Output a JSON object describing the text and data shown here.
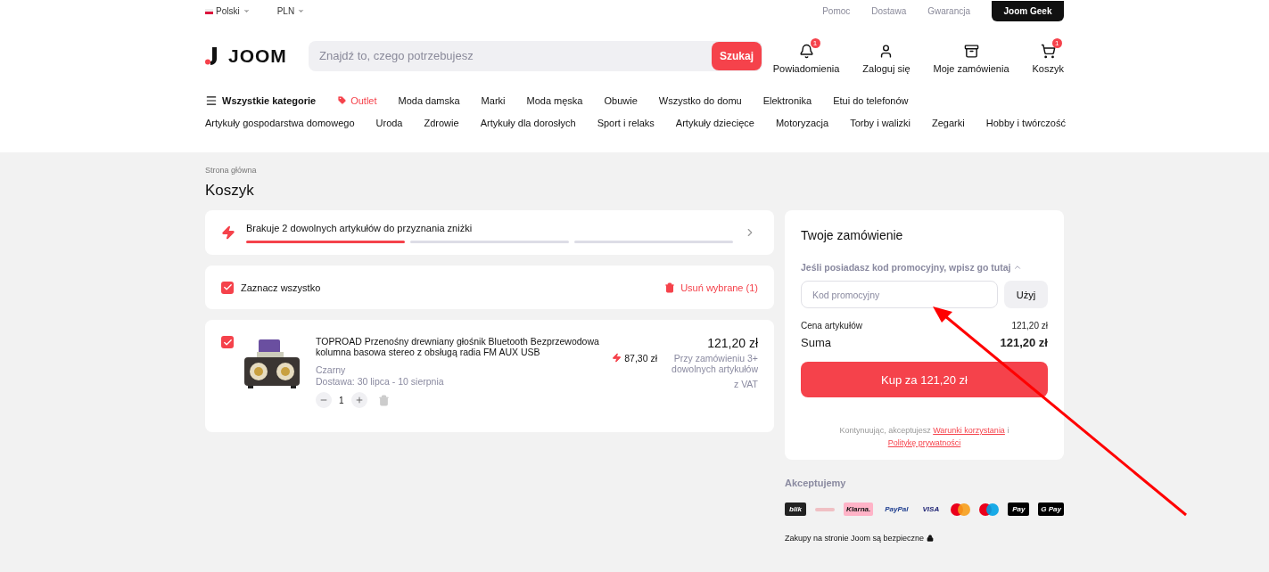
{
  "top_bar": {
    "language": "Polski",
    "currency": "PLN",
    "links": [
      "Pomoc",
      "Dostawa",
      "Gwarancja"
    ],
    "geek_button": "Joom Geek"
  },
  "header": {
    "logo": "JOOM",
    "search": {
      "placeholder": "Znajdź to, czego potrzebujesz",
      "button": "Szukaj"
    },
    "actions": [
      {
        "kind": "bell",
        "label": "Powiadomienia",
        "badge": "1"
      },
      {
        "kind": "user",
        "label": "Zaloguj się"
      },
      {
        "kind": "box",
        "label": "Moje zamówienia"
      },
      {
        "kind": "cart",
        "label": "Koszyk",
        "badge": "1"
      }
    ]
  },
  "categories": {
    "all": "Wszystkie kategorie",
    "row_1": [
      {
        "label": "Outlet",
        "kind": "promo"
      },
      {
        "label": "Moda damska",
        "kind": "plain"
      },
      {
        "label": "Marki",
        "kind": "plain"
      },
      {
        "label": "Moda męska",
        "kind": "plain"
      },
      {
        "label": "Obuwie",
        "kind": "plain"
      },
      {
        "label": "Wszystko do domu",
        "kind": "plain"
      },
      {
        "label": "Elektronika",
        "kind": "plain"
      },
      {
        "label": "Etui do telefonów",
        "kind": "plain"
      }
    ],
    "row_2": [
      "Artykuły gospodarstwa domowego",
      "Uroda",
      "Zdrowie",
      "Artykuły dla dorosłych",
      "Sport i relaks",
      "Artykuły dziecięce",
      "Motoryzacja",
      "Torby i walizki",
      "Zegarki",
      "Hobby i twórczość"
    ]
  },
  "breadcrumb": "Strona główna",
  "title": "Koszyk",
  "discount": {
    "text": "Brakuje 2 dowolnych artykułów do przyznania zniżki",
    "segments": [
      {
        "filled": true
      },
      {
        "filled": false
      },
      {
        "filled": false
      }
    ]
  },
  "select_all": {
    "label": "Zaznacz wszystko",
    "checked": true,
    "remove": "Usuń wybrane (1)"
  },
  "items": [
    {
      "checked": true,
      "name": "TOPROAD Przenośny drewniany głośnik Bluetooth Bezprzewodowa kolumna basowa stereo z obsługą radia FM AUX USB",
      "variant": "Czarny",
      "delivery": "Dostawa: 30 lipca - 10 sierpnia",
      "quantity": "1",
      "price": "121,20 zł",
      "bulk_price": "87,30 zł",
      "bulk_note": "Przy zamówieniu 3+ dowolnych artykułów",
      "vat": "z VAT"
    }
  ],
  "order": {
    "title": "Twoje zamówienie",
    "promo_toggle": "Jeśli posiadasz kod promocyjny, wpisz go tutaj",
    "promo_expanded": true,
    "promo_placeholder": "Kod promocyjny",
    "apply_button": "Użyj",
    "rows": [
      {
        "label": "Cena artykułów",
        "value": "121,20 zł",
        "kind": "normal"
      },
      {
        "label": "Suma",
        "value": "121,20 zł",
        "kind": "total"
      }
    ],
    "buy_button": "Kup za 121,20 zł",
    "terms_prefix": "Kontynuując, akceptujesz",
    "terms_link": "Warunki korzystania",
    "terms_and": "i",
    "privacy_link": "Politykę prywatności"
  },
  "payments": {
    "title": "Akceptujemy",
    "methods": [
      {
        "kind": "blik",
        "label": "blik"
      },
      {
        "kind": "p24"
      },
      {
        "kind": "klarna",
        "label": "Klarna."
      },
      {
        "kind": "paypal",
        "label": "PayPal"
      },
      {
        "kind": "visa",
        "label": "VISA"
      },
      {
        "kind": "mastercard"
      },
      {
        "kind": "maestro"
      },
      {
        "kind": "applepay",
        "label": "Pay"
      },
      {
        "kind": "gpay",
        "label": "G Pay"
      }
    ]
  },
  "safe_note": "Zakupy na stronie Joom są bezpieczne"
}
